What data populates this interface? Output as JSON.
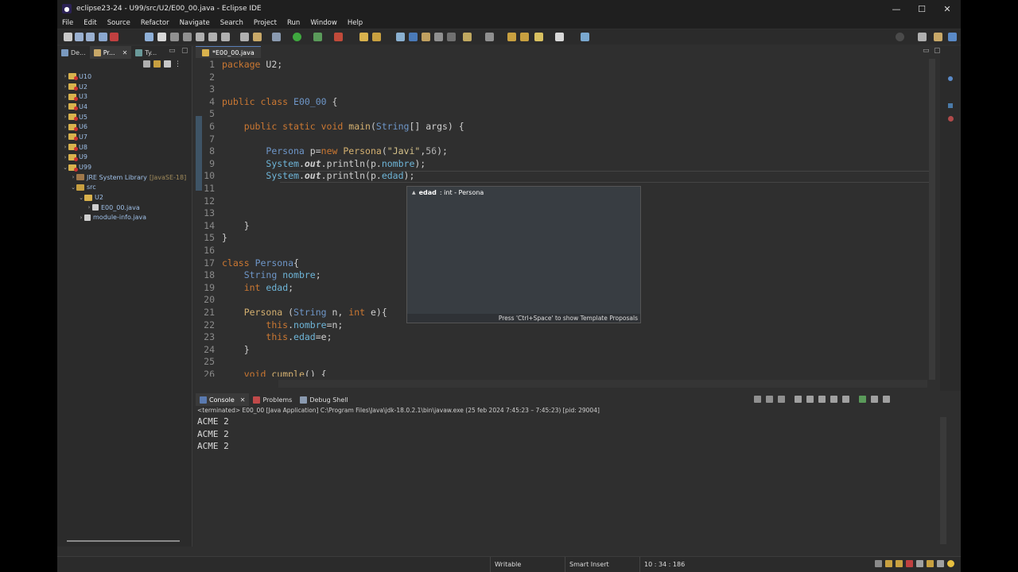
{
  "window": {
    "title": "eclipse23-24 - U99/src/U2/E00_00.java - Eclipse IDE",
    "minimize": "—",
    "maximize": "☐",
    "close": "✕"
  },
  "menu": [
    "File",
    "Edit",
    "Source",
    "Refactor",
    "Navigate",
    "Search",
    "Project",
    "Run",
    "Window",
    "Help"
  ],
  "left_panel": {
    "tabs": [
      {
        "label": "De..."
      },
      {
        "label": "Pr..."
      },
      {
        "label": "Ty..."
      }
    ],
    "tree": [
      {
        "label": "U10",
        "indent": 0,
        "arrow": "›",
        "kind": "project"
      },
      {
        "label": "U2",
        "indent": 0,
        "arrow": "›",
        "kind": "project"
      },
      {
        "label": "U3",
        "indent": 0,
        "arrow": "›",
        "kind": "project"
      },
      {
        "label": "U4",
        "indent": 0,
        "arrow": "›",
        "kind": "project"
      },
      {
        "label": "U5",
        "indent": 0,
        "arrow": "›",
        "kind": "project"
      },
      {
        "label": "U6",
        "indent": 0,
        "arrow": "›",
        "kind": "project"
      },
      {
        "label": "U7",
        "indent": 0,
        "arrow": "›",
        "kind": "project"
      },
      {
        "label": "U8",
        "indent": 0,
        "arrow": "›",
        "kind": "project"
      },
      {
        "label": "U9",
        "indent": 0,
        "arrow": "›",
        "kind": "project"
      },
      {
        "label": "U99",
        "indent": 0,
        "arrow": "⌄",
        "kind": "project"
      },
      {
        "label": "JRE System Library",
        "extra": "[JavaSE-18]",
        "indent": 1,
        "arrow": "›",
        "kind": "lib"
      },
      {
        "label": "src",
        "indent": 1,
        "arrow": "⌄",
        "kind": "folder"
      },
      {
        "label": "U2",
        "indent": 2,
        "arrow": "⌄",
        "kind": "package"
      },
      {
        "label": "E00_00.java",
        "indent": 3,
        "arrow": "›",
        "kind": "file"
      },
      {
        "label": "module-info.java",
        "indent": 2,
        "arrow": "›",
        "kind": "file"
      }
    ]
  },
  "editor": {
    "tab_label": "*E00_00.java",
    "lines": [
      {
        "n": "1",
        "parts": [
          [
            "kw",
            "package"
          ],
          [
            "plain",
            " U2;"
          ]
        ]
      },
      {
        "n": "2",
        "parts": []
      },
      {
        "n": "3",
        "parts": []
      },
      {
        "n": "4",
        "parts": [
          [
            "kw",
            "public class"
          ],
          [
            "plain",
            " "
          ],
          [
            "ty",
            "E00_00"
          ],
          [
            "plain",
            " {"
          ]
        ]
      },
      {
        "n": "5",
        "parts": []
      },
      {
        "n": "6",
        "parts": [
          [
            "plain",
            "    "
          ],
          [
            "kw",
            "public static void"
          ],
          [
            "plain",
            " "
          ],
          [
            "mth",
            "main"
          ],
          [
            "plain",
            "("
          ],
          [
            "ty",
            "String"
          ],
          [
            "plain",
            "[] args) {"
          ]
        ]
      },
      {
        "n": "7",
        "parts": []
      },
      {
        "n": "8",
        "parts": [
          [
            "plain",
            "        "
          ],
          [
            "ty",
            "Persona"
          ],
          [
            "plain",
            " p="
          ],
          [
            "kw",
            "new"
          ],
          [
            "plain",
            " "
          ],
          [
            "mth",
            "Persona"
          ],
          [
            "plain",
            "("
          ],
          [
            "str",
            "\"Javi\""
          ],
          [
            "plain",
            ","
          ],
          [
            "num",
            "56"
          ],
          [
            "plain",
            ");"
          ]
        ]
      },
      {
        "n": "9",
        "parts": [
          [
            "plain",
            "        "
          ],
          [
            "sys",
            "System"
          ],
          [
            "plain",
            "."
          ],
          [
            "it",
            "out"
          ],
          [
            "plain",
            ".println(p."
          ],
          [
            "fld",
            "nombre"
          ],
          [
            "plain",
            ");"
          ]
        ]
      },
      {
        "n": "10",
        "parts": [
          [
            "plain",
            "        "
          ],
          [
            "sys",
            "System"
          ],
          [
            "plain",
            "."
          ],
          [
            "it",
            "out"
          ],
          [
            "plain",
            ".println(p."
          ],
          [
            "fld",
            "edad"
          ],
          [
            "plain",
            ");"
          ]
        ]
      },
      {
        "n": "11",
        "parts": []
      },
      {
        "n": "12",
        "parts": []
      },
      {
        "n": "13",
        "parts": []
      },
      {
        "n": "14",
        "parts": [
          [
            "plain",
            "    }"
          ]
        ]
      },
      {
        "n": "15",
        "parts": [
          [
            "plain",
            "}"
          ]
        ]
      },
      {
        "n": "16",
        "parts": []
      },
      {
        "n": "17",
        "parts": [
          [
            "kw",
            "class"
          ],
          [
            "plain",
            " "
          ],
          [
            "ty",
            "Persona"
          ],
          [
            "plain",
            "{"
          ]
        ]
      },
      {
        "n": "18",
        "parts": [
          [
            "plain",
            "    "
          ],
          [
            "ty",
            "String"
          ],
          [
            "plain",
            " "
          ],
          [
            "fld",
            "nombre"
          ],
          [
            "plain",
            ";"
          ]
        ]
      },
      {
        "n": "19",
        "parts": [
          [
            "plain",
            "    "
          ],
          [
            "kw",
            "int"
          ],
          [
            "plain",
            " "
          ],
          [
            "fld",
            "edad"
          ],
          [
            "plain",
            ";"
          ]
        ]
      },
      {
        "n": "20",
        "parts": []
      },
      {
        "n": "21",
        "parts": [
          [
            "plain",
            "    "
          ],
          [
            "mth",
            "Persona"
          ],
          [
            "plain",
            " ("
          ],
          [
            "ty",
            "String"
          ],
          [
            "plain",
            " n, "
          ],
          [
            "kw",
            "int"
          ],
          [
            "plain",
            " e){"
          ]
        ]
      },
      {
        "n": "22",
        "parts": [
          [
            "plain",
            "        "
          ],
          [
            "kw",
            "this"
          ],
          [
            "plain",
            "."
          ],
          [
            "fld",
            "nombre"
          ],
          [
            "plain",
            "=n;"
          ]
        ]
      },
      {
        "n": "23",
        "parts": [
          [
            "plain",
            "        "
          ],
          [
            "kw",
            "this"
          ],
          [
            "plain",
            "."
          ],
          [
            "fld",
            "edad"
          ],
          [
            "plain",
            "=e;"
          ]
        ]
      },
      {
        "n": "24",
        "parts": [
          [
            "plain",
            "    }"
          ]
        ]
      },
      {
        "n": "25",
        "parts": []
      },
      {
        "n": "26",
        "parts": [
          [
            "plain",
            "    "
          ],
          [
            "kw",
            "void"
          ],
          [
            "plain",
            " "
          ],
          [
            "mth",
            "cumple"
          ],
          [
            "plain",
            "() {"
          ]
        ]
      }
    ]
  },
  "autocomplete": {
    "item_name": "edad",
    "item_detail": ": int - Persona",
    "footer": "Press 'Ctrl+Space' to show Template Proposals"
  },
  "console": {
    "tabs": [
      {
        "label": "Console"
      },
      {
        "label": "Problems"
      },
      {
        "label": "Debug Shell"
      }
    ],
    "info": "<terminated> E00_00 [Java Application] C:\\Program Files\\Java\\jdk-18.0.2.1\\bin\\javaw.exe  (25 feb 2024 7:45:23 – 7:45:23) [pid: 29004]",
    "output": [
      "ACME 2",
      "ACME 2",
      "ACME 2"
    ]
  },
  "status": {
    "writable": "Writable",
    "insert_mode": "Smart Insert",
    "position": "10 : 34 : 186"
  },
  "colors": {
    "keyword": "#cc7832",
    "type": "#6e96c8",
    "field": "#6eb5d8",
    "string": "#d6c28a"
  }
}
